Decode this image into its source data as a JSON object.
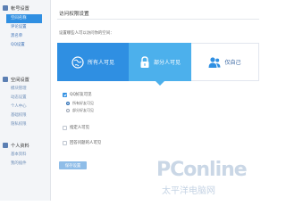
{
  "sidebar": {
    "sections": [
      {
        "icon": "account-settings-icon",
        "label": "帐号设置",
        "items": [
          {
            "label": "空间名称",
            "active": true
          },
          {
            "label": "评论设置",
            "active": false
          },
          {
            "label": "黑名单",
            "active": false
          },
          {
            "label": "QQ设置",
            "active": false
          }
        ]
      },
      {
        "icon": "space-settings-icon",
        "label": "空间设置",
        "items": [
          {
            "label": "模块管理",
            "active": false
          },
          {
            "label": "动态设置",
            "active": false
          },
          {
            "label": "个人中心",
            "active": false
          },
          {
            "label": "基础权限",
            "active": false
          },
          {
            "label": "隐私权限",
            "active": false
          }
        ]
      },
      {
        "icon": "profile-icon",
        "label": "个人资料",
        "items": [
          {
            "label": "基本资料",
            "active": false
          },
          {
            "label": "我的插件",
            "active": false
          }
        ]
      }
    ]
  },
  "main": {
    "title": "访问权限设置",
    "subtitle": "设置哪些人可以访问你的空间：",
    "visibility_panels": [
      {
        "label": "所有人可见",
        "icon": "globe-icon",
        "selected": false
      },
      {
        "label": "部分人可见",
        "icon": "lock-icon",
        "selected": true
      },
      {
        "label": "仅自己",
        "icon": "user-icon",
        "selected": false
      }
    ],
    "options": [
      {
        "label": "QQ好友可见",
        "checked": true
      },
      {
        "label": "指定人可见",
        "checked": false
      },
      {
        "label": "回答问题的人可见",
        "checked": false
      }
    ],
    "radios": [
      {
        "label": "所有好友可见",
        "checked": true
      },
      {
        "label": "部分好友可见",
        "checked": false
      }
    ],
    "save_label": "保存设置"
  },
  "watermark": {
    "logo": "PConline",
    "subtitle": "太平洋电脑网"
  },
  "colors": {
    "accent": "#2f8fe2",
    "panel_highlight": "#4cb0ec",
    "sidebar_bg": "#f3f5f8",
    "link": "#3a6fb5"
  }
}
